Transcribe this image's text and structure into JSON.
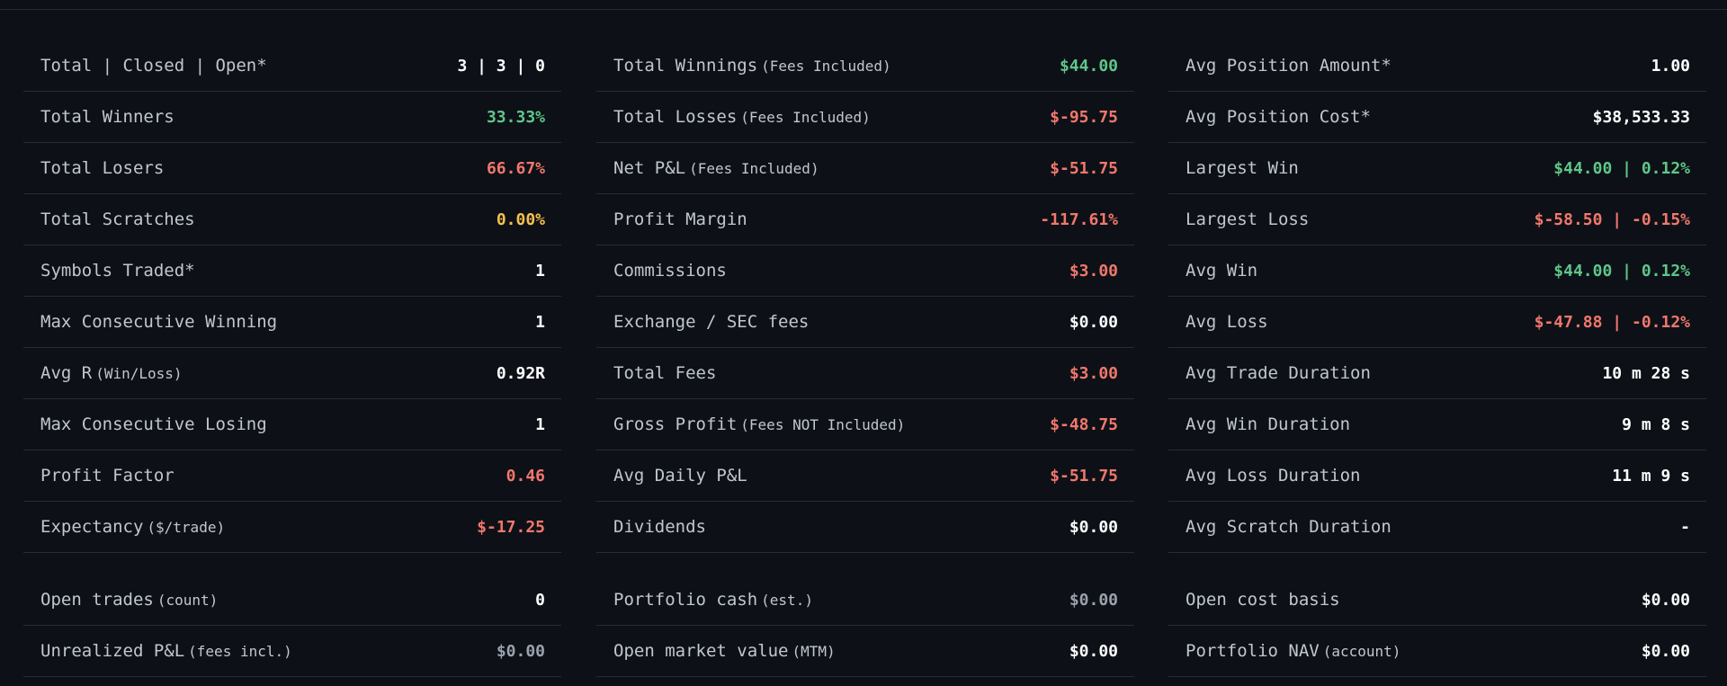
{
  "colors": {
    "background": "#0d1117",
    "divider": "#262c36",
    "label": "#c1c7cf",
    "white": "#ffffff",
    "green": "#5fc68a",
    "red": "#f2776c",
    "yellow": "#f5c04e",
    "gray": "#9aa2ad"
  },
  "columns": [
    {
      "stats": [
        {
          "label": "Total | Closed | Open*",
          "note": "",
          "value": "3 | 3 | 0",
          "tone": "white"
        },
        {
          "label": "Total Winners",
          "note": "",
          "value": "33.33%",
          "tone": "green"
        },
        {
          "label": "Total Losers",
          "note": "",
          "value": "66.67%",
          "tone": "red"
        },
        {
          "label": "Total Scratches",
          "note": "",
          "value": "0.00%",
          "tone": "yellow"
        },
        {
          "label": "Symbols Traded*",
          "note": "",
          "value": "1",
          "tone": "white"
        },
        {
          "label": "Max Consecutive Winning",
          "note": "",
          "value": "1",
          "tone": "white"
        },
        {
          "label": "Avg R",
          "note": "(Win/Loss)",
          "value": "0.92R",
          "tone": "white"
        },
        {
          "label": "Max Consecutive Losing",
          "note": "",
          "value": "1",
          "tone": "white"
        },
        {
          "label": "Profit Factor",
          "note": "",
          "value": "0.46",
          "tone": "red"
        },
        {
          "label": "Expectancy",
          "note": "($/trade)",
          "value": "$-17.25",
          "tone": "red"
        }
      ],
      "open": [
        {
          "label": "Open trades",
          "note": "(count)",
          "value": "0",
          "tone": "white"
        },
        {
          "label": "Unrealized P&L",
          "note": "(fees incl.)",
          "value": "$0.00",
          "tone": "gray"
        }
      ]
    },
    {
      "stats": [
        {
          "label": "Total Winnings",
          "note": "(Fees Included)",
          "value": "$44.00",
          "tone": "green"
        },
        {
          "label": "Total Losses",
          "note": "(Fees Included)",
          "value": "$-95.75",
          "tone": "red"
        },
        {
          "label": "Net P&L",
          "note": "(Fees Included)",
          "value": "$-51.75",
          "tone": "red"
        },
        {
          "label": "Profit Margin",
          "note": "",
          "value": "-117.61%",
          "tone": "red"
        },
        {
          "label": "Commissions",
          "note": "",
          "value": "$3.00",
          "tone": "red"
        },
        {
          "label": "Exchange / SEC fees",
          "note": "",
          "value": "$0.00",
          "tone": "white"
        },
        {
          "label": "Total Fees",
          "note": "",
          "value": "$3.00",
          "tone": "red"
        },
        {
          "label": "Gross Profit",
          "note": "(Fees NOT Included)",
          "value": "$-48.75",
          "tone": "red"
        },
        {
          "label": "Avg Daily P&L",
          "note": "",
          "value": "$-51.75",
          "tone": "red"
        },
        {
          "label": "Dividends",
          "note": "",
          "value": "$0.00",
          "tone": "white"
        }
      ],
      "open": [
        {
          "label": "Portfolio cash",
          "note": "(est.)",
          "value": "$0.00",
          "tone": "gray"
        },
        {
          "label": "Open market value",
          "note": "(MTM)",
          "value": "$0.00",
          "tone": "white"
        }
      ]
    },
    {
      "stats": [
        {
          "label": "Avg Position Amount*",
          "note": "",
          "value": "1.00",
          "tone": "white"
        },
        {
          "label": "Avg Position Cost*",
          "note": "",
          "value": "$38,533.33",
          "tone": "white"
        },
        {
          "label": "Largest Win",
          "note": "",
          "value": "$44.00 | 0.12%",
          "tone": "green"
        },
        {
          "label": "Largest Loss",
          "note": "",
          "value": "$-58.50 | -0.15%",
          "tone": "red"
        },
        {
          "label": "Avg Win",
          "note": "",
          "value": "$44.00 | 0.12%",
          "tone": "green"
        },
        {
          "label": "Avg Loss",
          "note": "",
          "value": "$-47.88 | -0.12%",
          "tone": "red"
        },
        {
          "label": "Avg Trade Duration",
          "note": "",
          "value": "10 m 28 s",
          "tone": "white"
        },
        {
          "label": "Avg Win Duration",
          "note": "",
          "value": "9 m 8 s",
          "tone": "white"
        },
        {
          "label": "Avg Loss Duration",
          "note": "",
          "value": "11 m 9 s",
          "tone": "white"
        },
        {
          "label": "Avg Scratch Duration",
          "note": "",
          "value": "-",
          "tone": "white"
        }
      ],
      "open": [
        {
          "label": "Open cost basis",
          "note": "",
          "value": "$0.00",
          "tone": "white"
        },
        {
          "label": "Portfolio NAV",
          "note": "(account)",
          "value": "$0.00",
          "tone": "white"
        }
      ]
    }
  ]
}
